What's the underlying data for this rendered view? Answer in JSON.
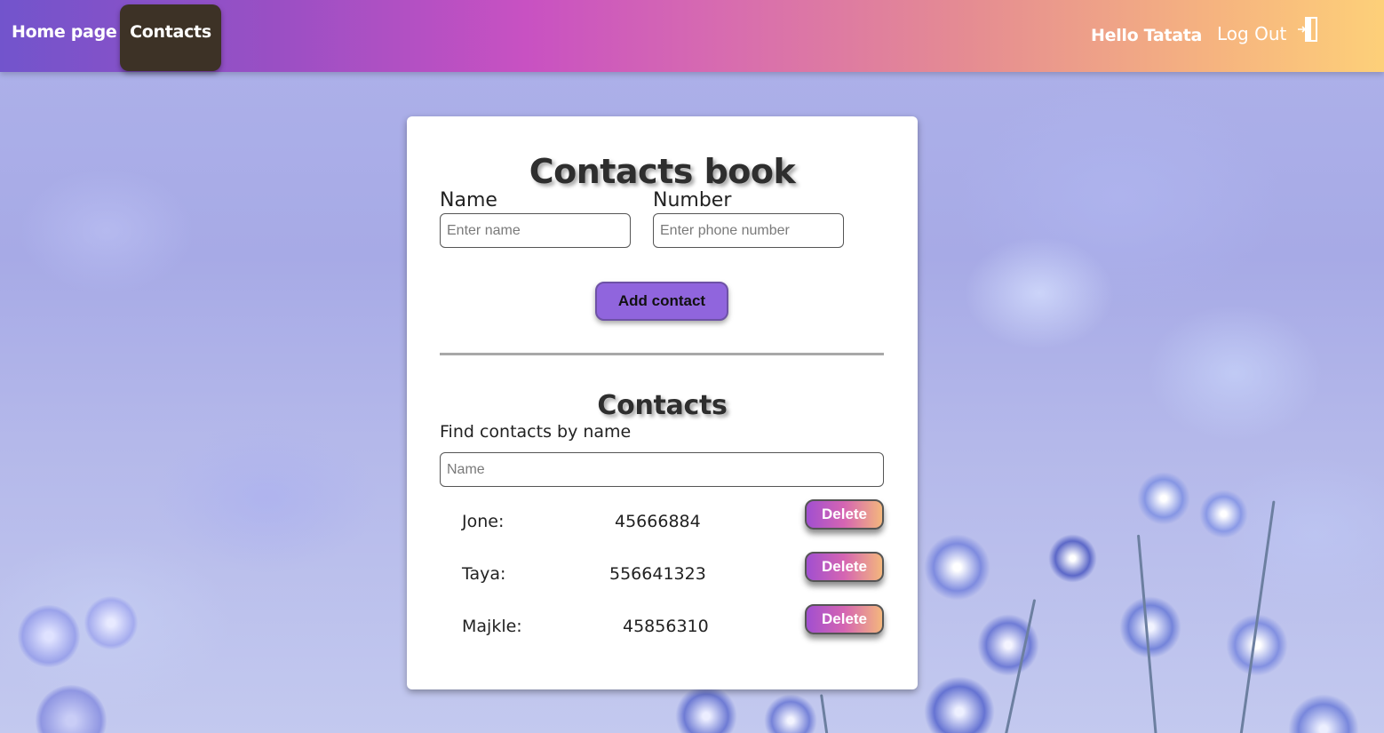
{
  "header": {
    "nav": [
      {
        "label": "Home page"
      },
      {
        "label": "Contacts"
      }
    ],
    "greeting": "Hello Tatata",
    "logout_label": "Log Out",
    "logout_icon": "door-exit-icon"
  },
  "card": {
    "title": "Contacts book",
    "form": {
      "name_label": "Name",
      "name_placeholder": "Enter name",
      "name_value": "",
      "number_label": "Number",
      "number_placeholder": "Enter phone number",
      "number_value": "",
      "submit_label": "Add contact"
    },
    "list": {
      "title": "Contacts",
      "filter_label": "Find contacts by name",
      "filter_placeholder": "Name",
      "filter_value": "",
      "delete_label": "Delete",
      "contacts": [
        {
          "name": "Jone:",
          "number": "45666884"
        },
        {
          "name": "Taya:",
          "number": "556641323"
        },
        {
          "name": "Majkle:",
          "number": "45856310"
        }
      ]
    }
  },
  "colors": {
    "header_gradient": [
      "#7254cc",
      "#c851c2",
      "#fdd079"
    ],
    "active_nav": "#3d3226",
    "add_button": "#9065dd"
  }
}
